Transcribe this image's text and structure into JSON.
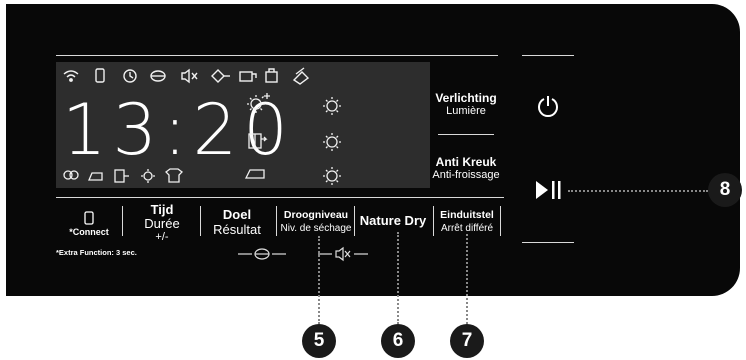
{
  "lcd": {
    "time": "13:20",
    "top_icons": [
      "wifi-icon",
      "phone-icon",
      "clock-icon",
      "spin-icon",
      "mute-icon",
      "pump-icon",
      "delay-icon",
      "child-lock-icon",
      "fabric-icon"
    ],
    "bottom_icons": [
      "cotton-icon",
      "iron-icon",
      "cabinet-icon",
      "sun-icon",
      "shirt-icon"
    ],
    "middle_icons": [
      "sun-plus-icon",
      "sun-icon",
      "sun-icon",
      "door-icon",
      "sun-icon",
      "iron-icon",
      "sun-icon"
    ]
  },
  "side": {
    "lighting_nl": "Verlichting",
    "lighting_fr": "Lumière",
    "anticrease_nl": "Anti Kreuk",
    "anticrease_fr": "Anti-froissage",
    "power_symbol": "⏻",
    "play_symbol": "▶II"
  },
  "buttons": {
    "connect": "*Connect",
    "tijd": "Tijd",
    "duree": "Durée",
    "plusminus": "+/-",
    "doel": "Doel",
    "resultat": "Résultat",
    "droogniveau": "Droogniveau",
    "niv_sechage": "Niv. de séchage",
    "nature_dry": "Nature Dry",
    "einduitstel": "Einduitstel",
    "arret_differe": "Arrêt différé"
  },
  "footer": {
    "extra_function": "*Extra Function: 3 sec."
  },
  "callouts": [
    "5",
    "6",
    "7",
    "8"
  ]
}
